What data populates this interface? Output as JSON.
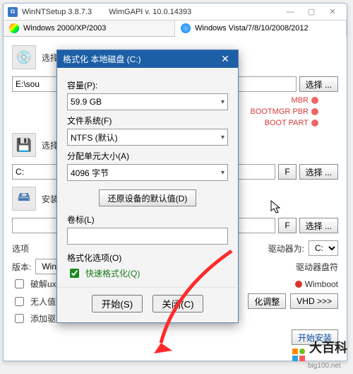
{
  "titlebar": {
    "app_name": "WinNTSetup 3.8.7.3",
    "api_label": "WimGAPI v. 10.0.14393"
  },
  "tabs": {
    "left": "Windows 2000/XP/2003",
    "right": "Windows Vista/7/8/10/2008/2012"
  },
  "main": {
    "sec1_title": "选择包含Windows安装文件的文件夹",
    "sec1_path": "E:\\sou",
    "select_btn": "选择 ...",
    "sec2_title": "选择",
    "sec2_path": "C:",
    "f_btn": "F",
    "sec3_title": "安装",
    "sec3_path": "",
    "options_label": "选项",
    "version_label": "版本:",
    "version_value": "Wind",
    "crack_label": "破解uxthe",
    "noattend_label": "无人值守",
    "adddriver_label": "添加驱动",
    "drivermap_label": "驱动器为:",
    "driver_value": "C:",
    "drivercheck_label": "驱动器盘符",
    "wimboot_label": "Wimboot",
    "tuning_btn": "化调整",
    "vhd_btn": "VHD",
    "start_install_btn": "开始安装"
  },
  "status": {
    "mbr": "MBR",
    "bootmgr": "BOOTMGR PBR",
    "bootpart": "BOOT PART"
  },
  "modal": {
    "title": "格式化 本地磁盘 (C:)",
    "capacity_label": "容量(P):",
    "capacity_value": "59.9 GB",
    "fs_label": "文件系统(F)",
    "fs_value": "NTFS (默认)",
    "au_label": "分配单元大小(A)",
    "au_value": "4096 字节",
    "restore_btn": "还原设备的默认值(D)",
    "vol_label": "卷标(L)",
    "vol_value": "",
    "fmt_opts_label": "格式化选项(O)",
    "quick_label": "快速格式化(Q)",
    "start_btn": "开始(S)",
    "close_btn": "关闭(C)"
  },
  "watermark": {
    "name": "大百科",
    "domain": "big100.net"
  }
}
